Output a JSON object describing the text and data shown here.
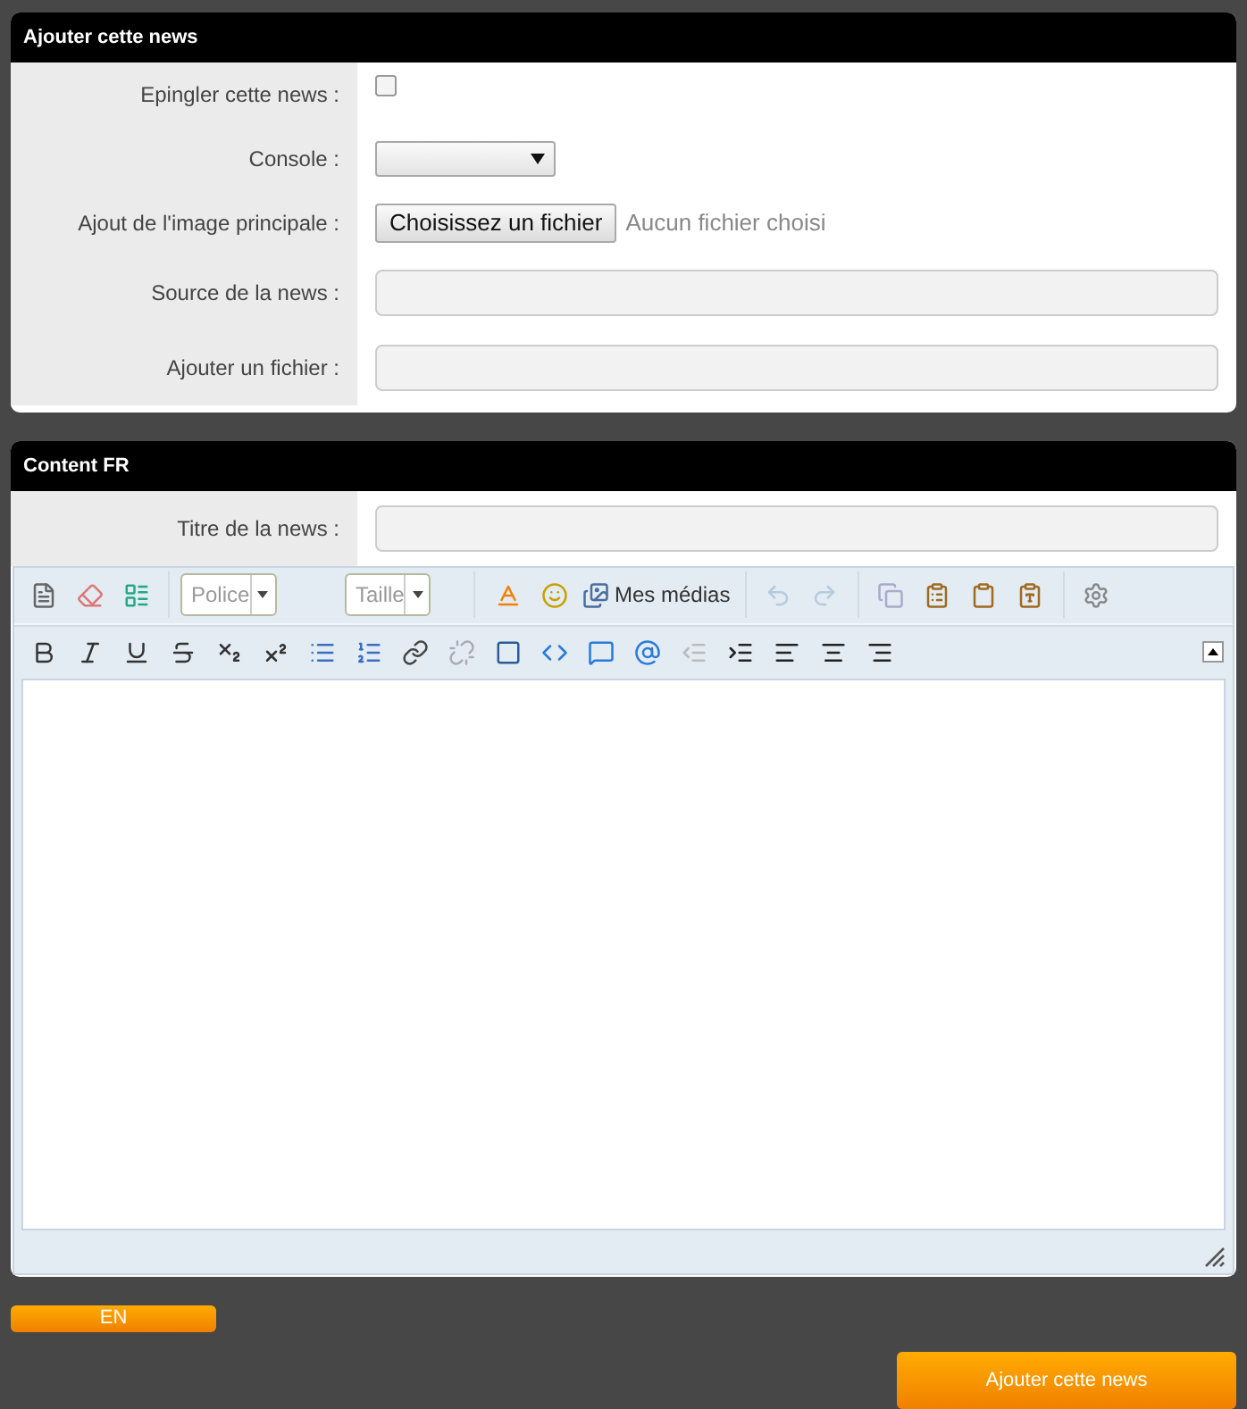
{
  "sections": [
    {
      "title": "Ajouter cette news",
      "fields": [
        {
          "kind": "checkbox",
          "label": "Epingler cette news :",
          "checked": false
        },
        {
          "kind": "select",
          "label": "Console :"
        },
        {
          "kind": "file",
          "label": "Ajout de l'image principale :",
          "button": "Choisissez un fichier",
          "status": "Aucun fichier choisi"
        },
        {
          "kind": "text",
          "label": "Source de la news :"
        },
        {
          "kind": "text",
          "label": "Ajouter un fichier :"
        }
      ]
    },
    {
      "title": "Content FR",
      "fields": [
        {
          "kind": "text",
          "label": "Titre de la news :"
        }
      ],
      "editor": {
        "font_placeholder": "Police",
        "size_placeholder": "Taille",
        "media_button": "Mes médias"
      }
    }
  ],
  "language_button": "EN",
  "submit_button": "Ajouter cette news"
}
